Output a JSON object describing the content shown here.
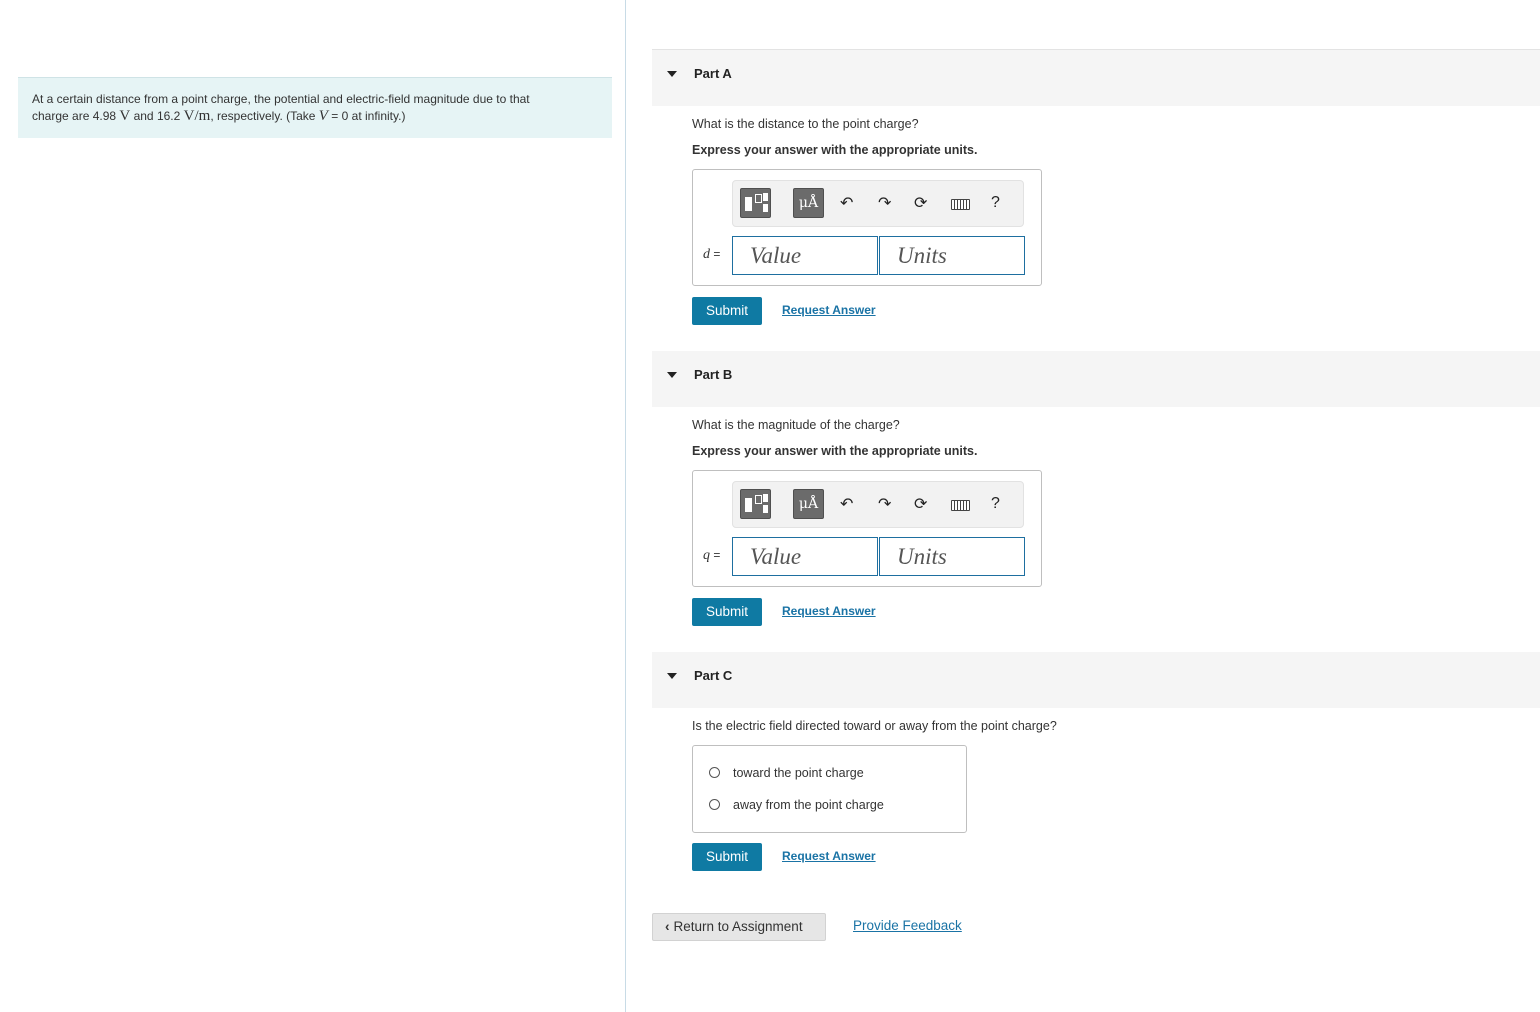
{
  "problem": {
    "text_1": "At a certain distance from a point charge, the potential and electric-field magnitude due to that",
    "text_2a": "charge are 4.98 ",
    "unit_v": "V",
    "text_2b": " and 16.2 ",
    "unit_vm": "V/m",
    "text_2c": ", respectively. (Take ",
    "var_v": "V",
    "text_2d": " = 0 at infinity.)"
  },
  "part_a": {
    "title": "Part A",
    "question": "What is the distance to the point charge?",
    "instruction": "Express your answer with the appropriate units.",
    "var": "d",
    "eq": " =",
    "value_placeholder": "Value",
    "units_placeholder": "Units",
    "submit": "Submit",
    "request": "Request Answer"
  },
  "part_b": {
    "title": "Part B",
    "question": "What is the magnitude of the charge?",
    "instruction": "Express your answer with the appropriate units.",
    "var": "q",
    "eq": " =",
    "value_placeholder": "Value",
    "units_placeholder": "Units",
    "submit": "Submit",
    "request": "Request Answer"
  },
  "part_c": {
    "title": "Part C",
    "question": "Is the electric field directed toward or away from the point charge?",
    "options": [
      "toward the point charge",
      "away from the point charge"
    ],
    "submit": "Submit",
    "request": "Request Answer"
  },
  "toolbar": {
    "units_label": "μÅ",
    "undo_icon": "↶",
    "redo_icon": "↷",
    "reset_icon": "⟳",
    "help": "?"
  },
  "footer": {
    "return_chevron": "‹",
    "return": "Return to Assignment",
    "feedback": "Provide Feedback"
  }
}
